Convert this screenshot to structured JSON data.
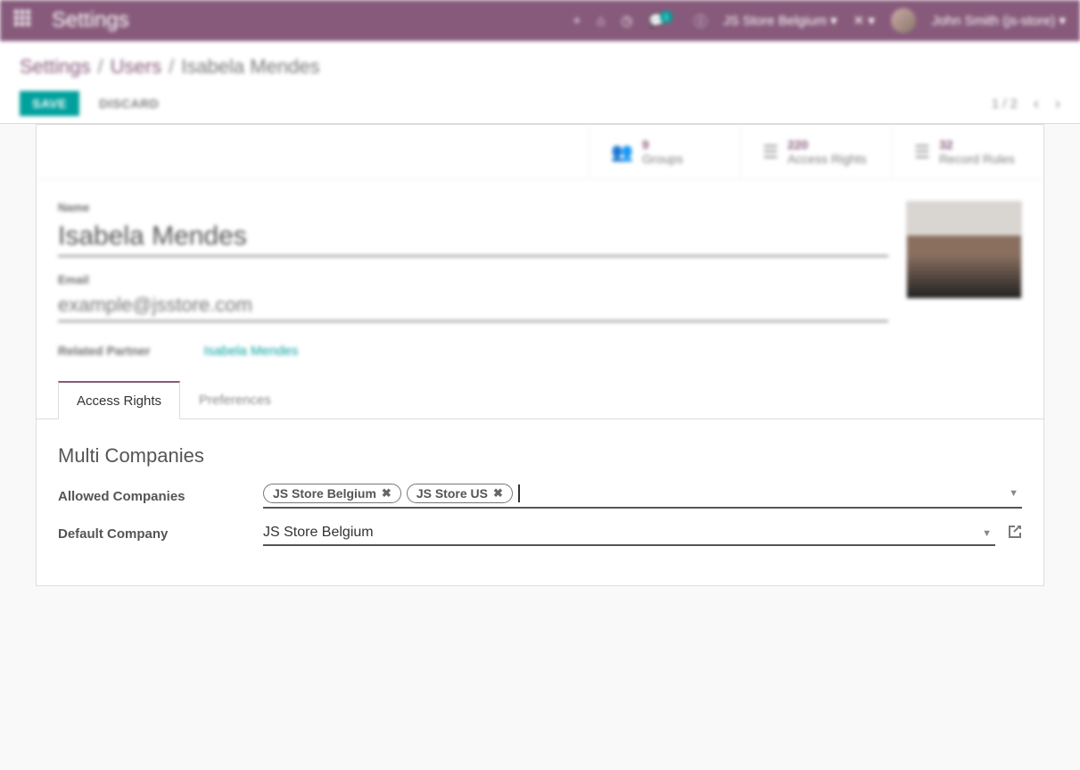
{
  "topbar": {
    "brand": "Settings",
    "plus": "+",
    "notif_count": "1",
    "company": "JS Store Belgium",
    "user": "John Smith (js-store)"
  },
  "breadcrumb": {
    "a": "Settings",
    "b": "Users",
    "c": "Isabela Mendes"
  },
  "actions": {
    "save": "SAVE",
    "discard": "DISCARD",
    "pager": "1 / 2"
  },
  "stats": {
    "groups_n": "9",
    "groups_l": "Groups",
    "access_n": "220",
    "access_l": "Access Rights",
    "rules_n": "32",
    "rules_l": "Record Rules"
  },
  "form": {
    "name_label": "Name",
    "name_value": "Isabela Mendes",
    "email_label": "Email",
    "email_value": "example@jsstore.com",
    "related_label": "Related Partner",
    "related_value": "Isabela Mendes"
  },
  "tabs": {
    "access": "Access Rights",
    "prefs": "Preferences"
  },
  "multi": {
    "title": "Multi Companies",
    "allowed_label": "Allowed Companies",
    "tag1": "JS Store Belgium",
    "tag2": "JS Store US",
    "default_label": "Default Company",
    "default_value": "JS Store Belgium"
  }
}
